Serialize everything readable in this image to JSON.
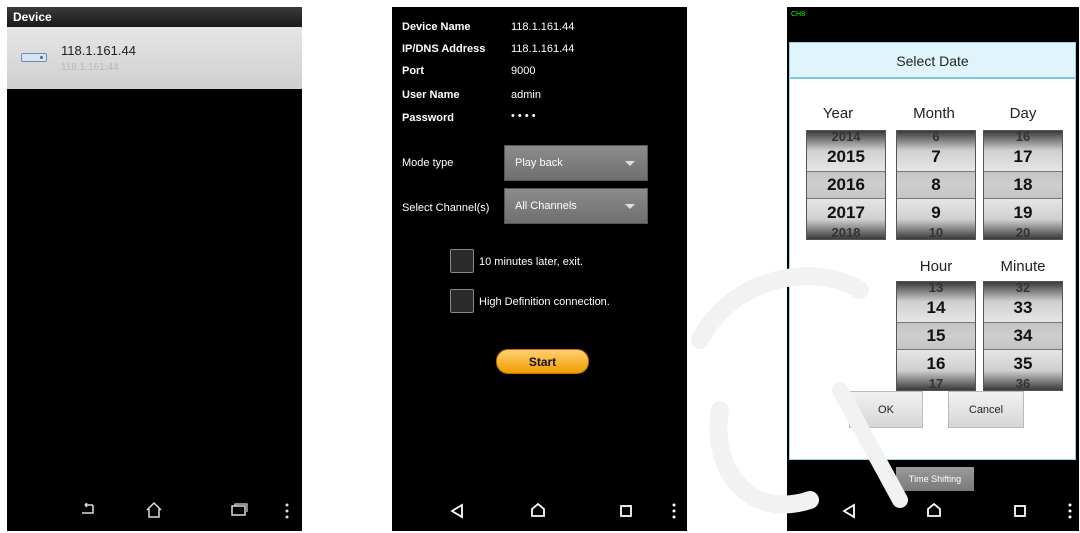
{
  "screen1": {
    "title": "Device",
    "device": {
      "name": "118.1.161.44",
      "address": "118.1.161.44"
    },
    "nav": {
      "back_icon": "back-icon",
      "home_icon": "home-icon",
      "recents_icon": "recents-icon",
      "menu_icon": "menu-icon"
    }
  },
  "screen2": {
    "info": [
      {
        "label": "Device Name",
        "value": "118.1.161.44"
      },
      {
        "label": "IP/DNS Address",
        "value": "118.1.161.44"
      },
      {
        "label": "Port",
        "value": "9000"
      },
      {
        "label": "User Name",
        "value": "admin"
      },
      {
        "label": "Password",
        "value": "• • • •"
      }
    ],
    "mode_label": "Mode type",
    "mode_value": "Play back",
    "channel_label": "Select Channel(s)",
    "channel_value": "All Channels",
    "checkbox1": "10 minutes later, exit.",
    "checkbox2": "High Definition connection.",
    "start": "Start"
  },
  "screen3": {
    "status": "CH8",
    "dialog_title": "Select Date",
    "columns": {
      "year": "Year",
      "month": "Month",
      "day": "Day",
      "hour": "Hour",
      "minute": "Minute"
    },
    "year": {
      "prev": "2014",
      "items": [
        "2015",
        "2016",
        "2017"
      ],
      "next": "2018"
    },
    "month": {
      "prev": "6",
      "items": [
        "7",
        "8",
        "9"
      ],
      "next": "10"
    },
    "day": {
      "prev": "16",
      "items": [
        "17",
        "18",
        "19"
      ],
      "next": "20"
    },
    "hour": {
      "prev": "13",
      "items": [
        "14",
        "15",
        "16"
      ],
      "next": "17"
    },
    "minute": {
      "prev": "32",
      "items": [
        "33",
        "34",
        "35"
      ],
      "next": "36"
    },
    "ok": "OK",
    "cancel": "Cancel",
    "time_shifting": "Time Shifting"
  }
}
